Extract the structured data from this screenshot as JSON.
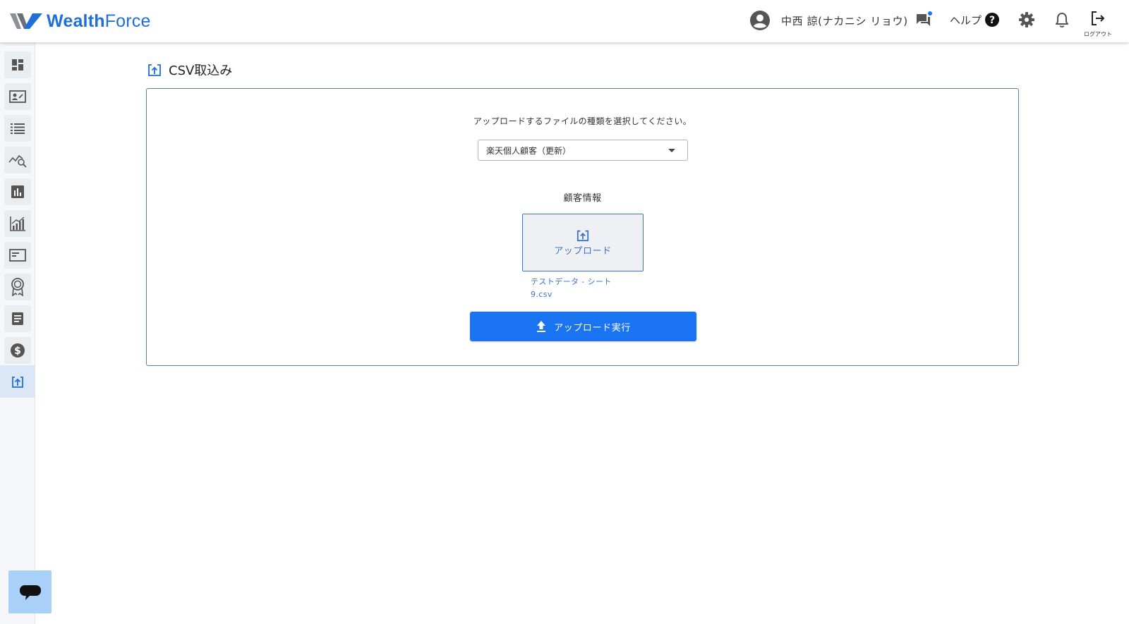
{
  "header": {
    "logo_word1": "Wealth",
    "logo_word2": "Force",
    "user_name": "中西 諒(ナカニシ リョウ)",
    "help_label": "ヘルプ",
    "logout_label": "ログアウト"
  },
  "sidebar": {
    "items": [
      {
        "icon": "dashboard-icon"
      },
      {
        "icon": "contact-card-icon"
      },
      {
        "icon": "list-icon"
      },
      {
        "icon": "analytics-search-icon"
      },
      {
        "icon": "bar-chart-icon"
      },
      {
        "icon": "growth-chart-icon"
      },
      {
        "icon": "window-icon"
      },
      {
        "icon": "award-icon"
      },
      {
        "icon": "document-icon"
      },
      {
        "icon": "dollar-icon"
      },
      {
        "icon": "csv-import-icon",
        "active": true
      }
    ]
  },
  "page": {
    "title": "CSV取込み"
  },
  "form": {
    "instruction": "アップロードするファイルの種類を選択してください。",
    "file_type_selected": "楽天個人顧客（更新）",
    "section_label": "顧客情報",
    "upload_label": "アップロード",
    "file_name_line1": "テストデータ - シート",
    "file_name_line2": "9.csv",
    "execute_label": "アップロード実行"
  },
  "colors": {
    "brand": "#1e6fd9",
    "primary_button": "#1a73f0",
    "upload_text": "#3b73c8",
    "active_sidebar": "#dbe7f7",
    "chat_fab": "#a8d0f8"
  }
}
